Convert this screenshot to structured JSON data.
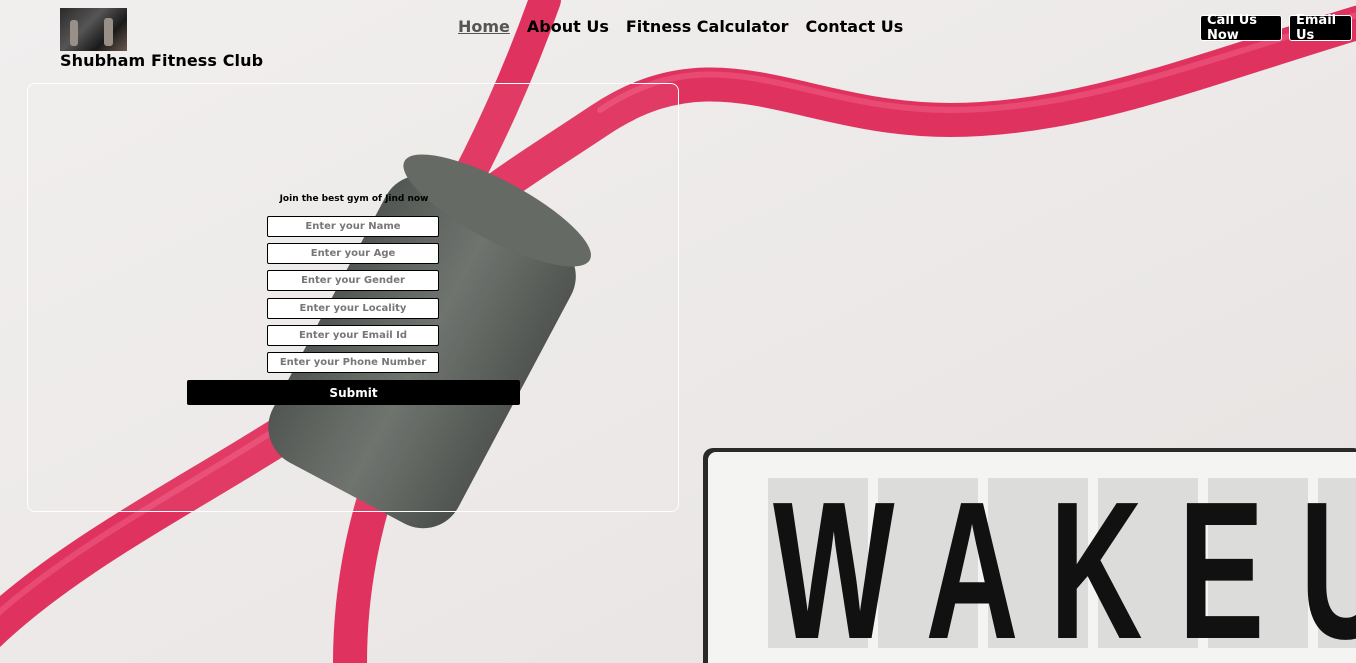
{
  "header": {
    "brand": "Shubham Fitness Club",
    "nav": [
      "Home",
      "About Us",
      "Fitness Calculator",
      "Contact Us"
    ],
    "call_label": "Call Us Now",
    "email_label": "Email Us"
  },
  "form": {
    "title": "Join the best gym of Jind now",
    "fields": [
      "Enter your Name",
      "Enter your Age",
      "Enter your Gender",
      "Enter your Locality",
      "Enter your Email Id",
      "Enter your Phone Number"
    ],
    "submit_label": "Submit"
  },
  "background": {
    "lightbox_text": "WAKE U"
  },
  "colors": {
    "band": "#e0325f",
    "grip": "#5d625d",
    "button": "#000000"
  }
}
